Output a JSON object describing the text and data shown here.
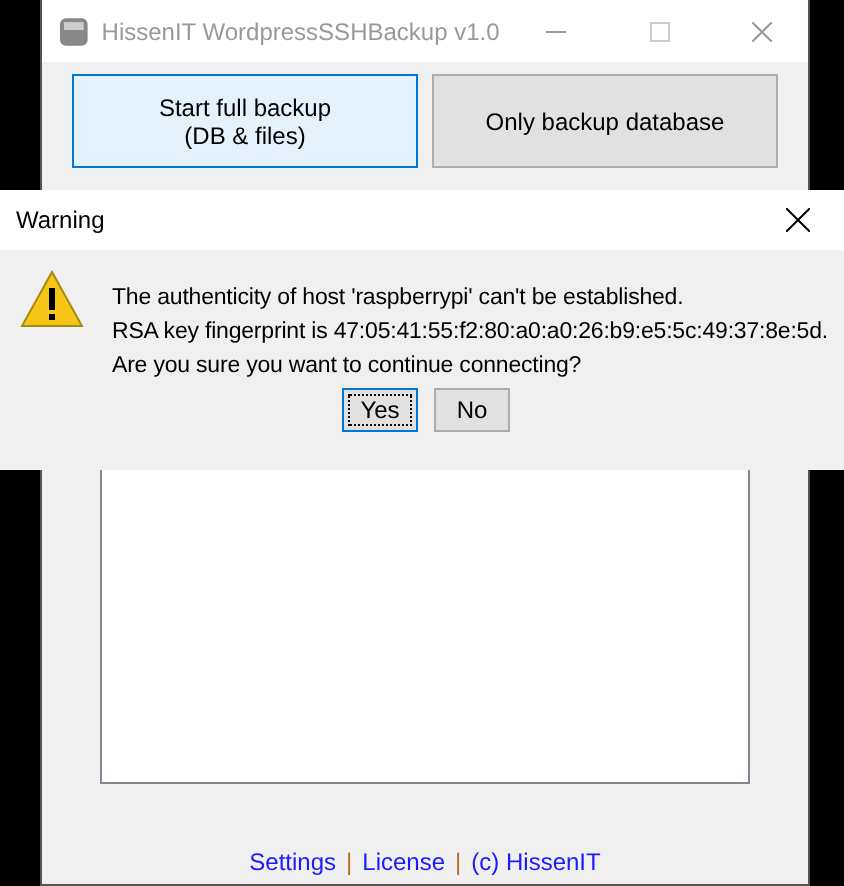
{
  "main_window": {
    "title": "HissenIT WordpressSSHBackup v1.0",
    "buttons": [
      {
        "label": "Start full backup\n(DB & files)",
        "selected": true
      },
      {
        "label": "Only backup database",
        "selected": false
      }
    ],
    "footer": [
      {
        "kind": "link",
        "text": "Settings"
      },
      {
        "kind": "separator",
        "text": "|"
      },
      {
        "kind": "link",
        "text": "License"
      },
      {
        "kind": "separator",
        "text": "|"
      },
      {
        "kind": "link",
        "text": "(c) HissenIT"
      }
    ]
  },
  "dialog": {
    "title": "Warning",
    "lines": [
      "The authenticity of host 'raspberrypi' can't be established.",
      "RSA key fingerprint is 47:05:41:55:f2:80:a0:a0:26:b9:e5:5c:49:37:8e:5d.",
      "Are you sure you want to continue connecting?"
    ],
    "buttons": [
      {
        "label": "Yes",
        "selected": true
      },
      {
        "label": "No",
        "selected": false
      }
    ]
  }
}
